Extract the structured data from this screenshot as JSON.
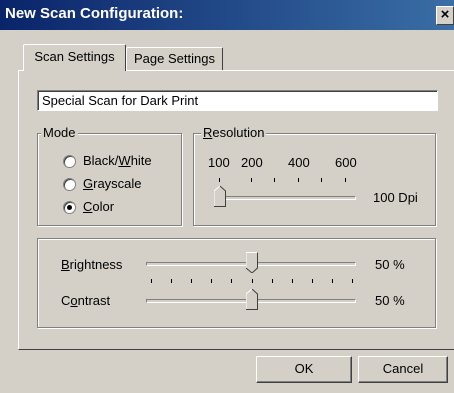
{
  "window": {
    "title": "New Scan Configuration:",
    "close_glyph": "×"
  },
  "tabs": [
    {
      "label": "Scan Settings",
      "selected": true
    },
    {
      "label": "Page Settings",
      "selected": false
    }
  ],
  "config_name": {
    "value": "Special Scan for Dark Print"
  },
  "mode": {
    "label_underline": "",
    "label_rest": "Mode",
    "options": [
      {
        "before": "Black/",
        "underline": "W",
        "after": "hite",
        "selected": false
      },
      {
        "before": "",
        "underline": "G",
        "after": "rayscale",
        "selected": false
      },
      {
        "before": "",
        "underline": "C",
        "after": "olor",
        "selected": true
      }
    ]
  },
  "resolution": {
    "label_underline": "R",
    "label_rest": "esolution",
    "scale_labels": [
      "100",
      "200",
      "400",
      "600"
    ],
    "value_text": "100 Dpi",
    "level": 0
  },
  "adjustments": {
    "brightness": {
      "underline": "B",
      "rest": "rightness",
      "value_text": "50 %",
      "level": 0.5
    },
    "contrast": {
      "before": "C",
      "underline": "o",
      "rest": "ntrast",
      "value_text": "50 %",
      "level": 0.5
    }
  },
  "buttons": {
    "ok": "OK",
    "cancel": "Cancel"
  }
}
